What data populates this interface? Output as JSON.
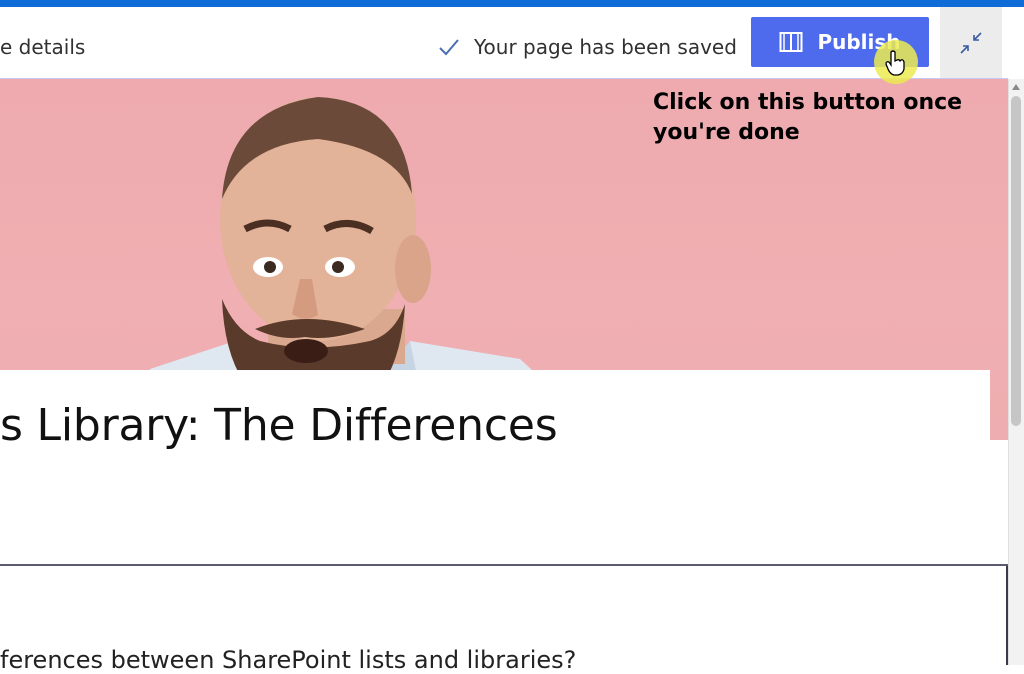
{
  "command_bar": {
    "left_text": "e details",
    "saved_status": "Your page has been saved",
    "publish_label": "Publish"
  },
  "annotation": "Click on this button once you're done",
  "page": {
    "title": "s Library: The Differences",
    "body_partial": "ferences between SharePoint lists and libraries?"
  },
  "icons": {
    "saved": "checkmark-icon",
    "publish": "book-icon",
    "collapse": "collapse-arrows-icon",
    "cursor": "hand-pointer-icon"
  },
  "colors": {
    "top_accent": "#0f6cd6",
    "publish_button": "#4f6bed",
    "hero_background": "#f0afb2"
  }
}
